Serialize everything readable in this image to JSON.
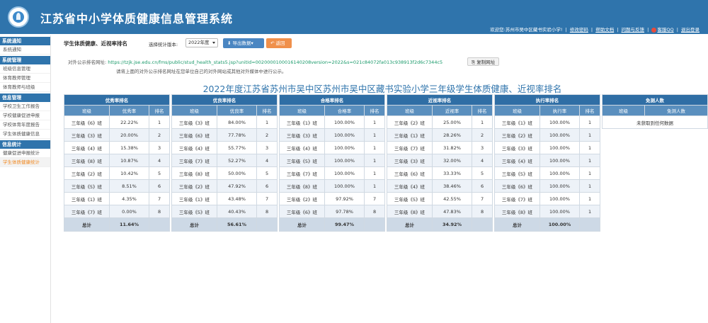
{
  "header": {
    "app_title": "江苏省中小学体质健康信息管理系统",
    "welcome": "欢迎您:苏州市吴中区藏书实验小学!",
    "links": [
      "修改密码",
      "帮助文档",
      "问题与反馈"
    ],
    "qq_label": "客服QQ",
    "logout": "退出登录"
  },
  "sidebar": {
    "groups": [
      {
        "title": "系统通知",
        "items": [
          "系统通知"
        ]
      },
      {
        "title": "系统管理",
        "items": [
          "班级信息管理",
          "体育教师管理",
          "体育教师与班级"
        ]
      },
      {
        "title": "信息管理",
        "items": [
          "学校卫生工作报告",
          "学校健康促进申报",
          "学校体育年度报告",
          "学生体质健康信息"
        ]
      },
      {
        "title": "信息统计",
        "items": [
          "健康促进申报统计",
          "学生体质健康统计"
        ]
      }
    ]
  },
  "toolbar": {
    "page_title": "学生体质健康、近视率排名",
    "version_label": "选择统计版本:",
    "version_value": "2022年度",
    "export_label": "导出数据▾",
    "back_label": "返回"
  },
  "public_url": {
    "label": "对外公示排名网址:",
    "url": "https://tzjk.jse.edu.cn/fms/public/stud_health_stats5.jsp?unitId=0020000100016140208version=2022&s=021c84072fa013c938913f2d6c7344c5",
    "copy_label": "复制网址",
    "note": "请将上面的对外公示排名网址在您单位自己的对外网站或其他对外媒体中进行公示。"
  },
  "report_title": "2022年度江苏省苏州市吴中区苏州市吴中区藏书实验小学三年级学生体质健康、近视率排名",
  "tables": [
    {
      "title": "优秀率排名",
      "headers": [
        "班级",
        "优秀率",
        "排名"
      ],
      "rows": [
        [
          "三年级《6》班",
          "22.22%",
          "1"
        ],
        [
          "三年级《3》班",
          "20.00%",
          "2"
        ],
        [
          "三年级《4》班",
          "15.38%",
          "3"
        ],
        [
          "三年级《8》班",
          "10.87%",
          "4"
        ],
        [
          "三年级《2》班",
          "10.42%",
          "5"
        ],
        [
          "三年级《5》班",
          "8.51%",
          "6"
        ],
        [
          "三年级《1》班",
          "4.35%",
          "7"
        ],
        [
          "三年级《7》班",
          "0.00%",
          "8"
        ]
      ],
      "total_label": "总计",
      "total_value": "11.64%"
    },
    {
      "title": "优良率排名",
      "headers": [
        "班级",
        "优良率",
        "排名"
      ],
      "rows": [
        [
          "三年级《3》班",
          "84.00%",
          "1"
        ],
        [
          "三年级《6》班",
          "77.78%",
          "2"
        ],
        [
          "三年级《4》班",
          "55.77%",
          "3"
        ],
        [
          "三年级《7》班",
          "52.27%",
          "4"
        ],
        [
          "三年级《8》班",
          "50.00%",
          "5"
        ],
        [
          "三年级《2》班",
          "47.92%",
          "6"
        ],
        [
          "三年级《1》班",
          "43.48%",
          "7"
        ],
        [
          "三年级《5》班",
          "40.43%",
          "8"
        ]
      ],
      "total_label": "总计",
      "total_value": "56.61%"
    },
    {
      "title": "合格率排名",
      "headers": [
        "班级",
        "合格率",
        "排名"
      ],
      "rows": [
        [
          "三年级《1》班",
          "100.00%",
          "1"
        ],
        [
          "三年级《3》班",
          "100.00%",
          "1"
        ],
        [
          "三年级《4》班",
          "100.00%",
          "1"
        ],
        [
          "三年级《5》班",
          "100.00%",
          "1"
        ],
        [
          "三年级《7》班",
          "100.00%",
          "1"
        ],
        [
          "三年级《8》班",
          "100.00%",
          "1"
        ],
        [
          "三年级《2》班",
          "97.92%",
          "7"
        ],
        [
          "三年级《6》班",
          "97.78%",
          "8"
        ]
      ],
      "total_label": "总计",
      "total_value": "99.47%"
    },
    {
      "title": "近视率排名",
      "headers": [
        "班级",
        "近视率",
        "排名"
      ],
      "rows": [
        [
          "三年级《2》班",
          "25.00%",
          "1"
        ],
        [
          "三年级《1》班",
          "28.26%",
          "2"
        ],
        [
          "三年级《7》班",
          "31.82%",
          "3"
        ],
        [
          "三年级《3》班",
          "32.00%",
          "4"
        ],
        [
          "三年级《6》班",
          "33.33%",
          "5"
        ],
        [
          "三年级《4》班",
          "38.46%",
          "6"
        ],
        [
          "三年级《5》班",
          "42.55%",
          "7"
        ],
        [
          "三年级《8》班",
          "47.83%",
          "8"
        ]
      ],
      "total_label": "总计",
      "total_value": "34.92%"
    },
    {
      "title": "执行率排名",
      "headers": [
        "班级",
        "执行率",
        "排名"
      ],
      "rows": [
        [
          "三年级《1》班",
          "100.00%",
          "1"
        ],
        [
          "三年级《2》班",
          "100.00%",
          "1"
        ],
        [
          "三年级《3》班",
          "100.00%",
          "1"
        ],
        [
          "三年级《4》班",
          "100.00%",
          "1"
        ],
        [
          "三年级《5》班",
          "100.00%",
          "1"
        ],
        [
          "三年级《6》班",
          "100.00%",
          "1"
        ],
        [
          "三年级《7》班",
          "100.00%",
          "1"
        ],
        [
          "三年级《8》班",
          "100.00%",
          "1"
        ]
      ],
      "total_label": "总计",
      "total_value": "100.00%"
    }
  ],
  "exempt_table": {
    "title": "免测人数",
    "headers": [
      "班级",
      "免测人数"
    ],
    "empty_message": "未获取到任何数据"
  }
}
